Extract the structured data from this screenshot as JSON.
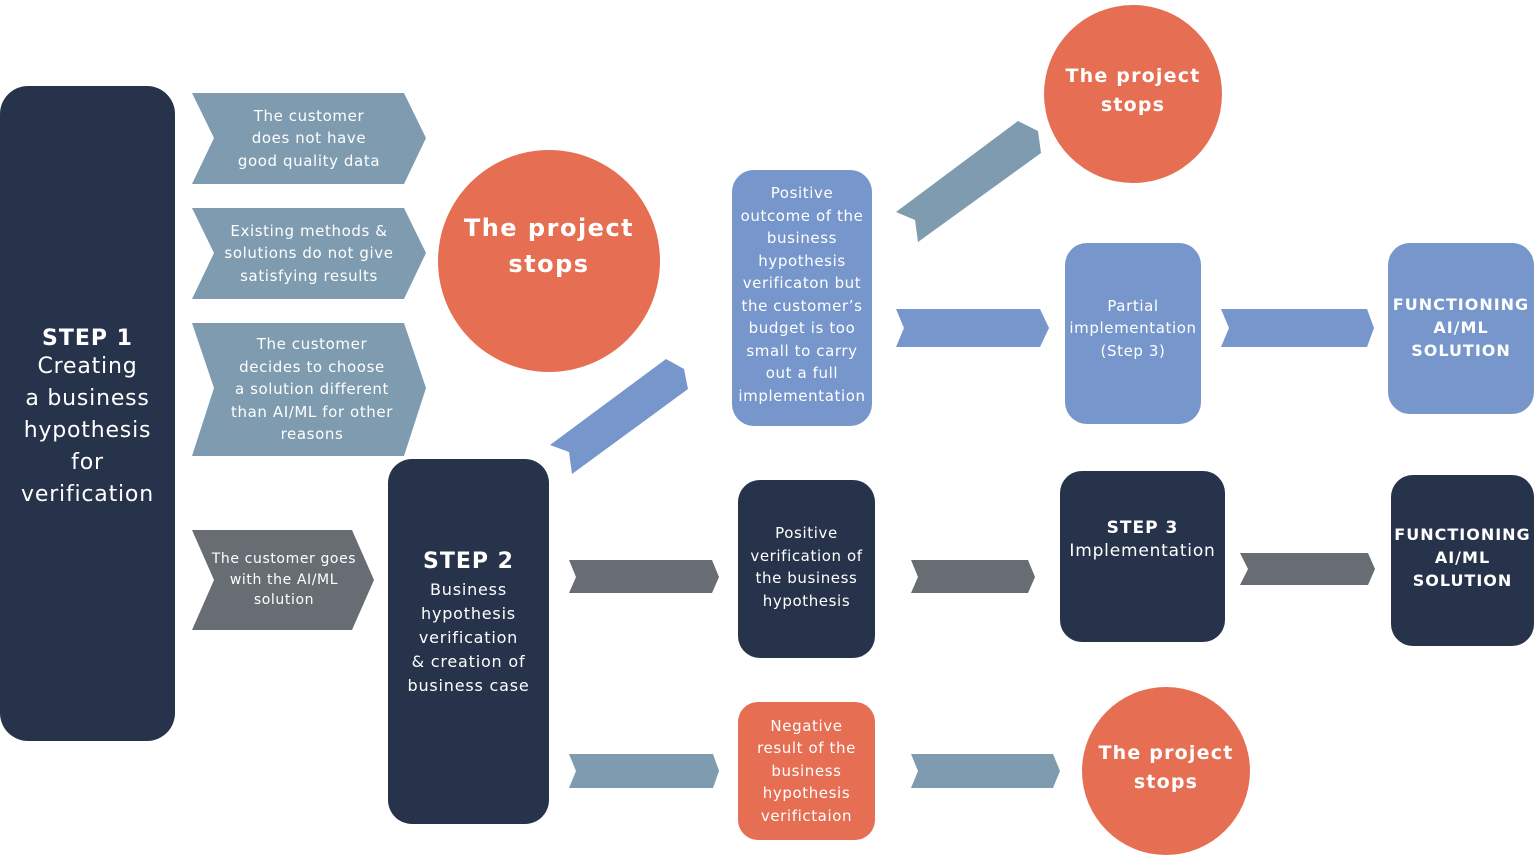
{
  "colors": {
    "navy": "#27334a",
    "blue": "#7696cc",
    "orange": "#e66e53",
    "steel": "#7e9bb0",
    "grey": "#686d73"
  },
  "step1": {
    "title": "STEP 1",
    "body": "Creating\na business\nhypothesis\nfor\nverification"
  },
  "reasons": [
    "The customer\ndoes not have\ngood quality data",
    "Existing methods &\nsolutions do not give\nsatisfying results",
    "The customer\ndecides to choose\na solution different\nthan AI/ML for other\nreasons"
  ],
  "go_ahead": "The customer goes\nwith the AI/ML\nsolution",
  "stops": {
    "main": "The project\nstops",
    "top": "The project\nstops",
    "bottom": "The project\nstops"
  },
  "step2": {
    "title": "STEP 2",
    "body": "Business\nhypothesis\nverification\n& creation of\nbusiness case"
  },
  "outcomes": {
    "partial_positive": "Positive\noutcome of the\nbusiness\nhypothesis\nverificaton but\nthe customer’s\nbudget is too\nsmall to carry\nout a full\nimplementation",
    "positive": "Positive\nverification of\nthe business\nhypothesis",
    "negative": "Negative\nresult of the\nbusiness\nhypothesis\nverifictaion"
  },
  "partial_impl": "Partial\nimplementation\n(Step 3)",
  "step3": {
    "title": "STEP 3",
    "body": "Implementation"
  },
  "solution": {
    "blue": "FUNCTIONING\nAI/ML\nSOLUTION",
    "navy": "FUNCTIONING\nAI/ML\nSOLUTION"
  }
}
